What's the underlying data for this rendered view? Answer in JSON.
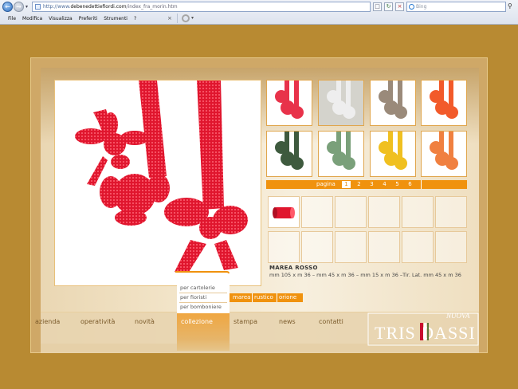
{
  "browser": {
    "address": {
      "prefix": "http://www.",
      "host": "debenedettiefiordi.com",
      "path": "/index_fra_morin.htm"
    },
    "search_placeholder": "Bing",
    "menu": [
      "File",
      "Modifica",
      "Visualizza",
      "Preferiti",
      "Strumenti",
      "?"
    ]
  },
  "site": {
    "thumbnails": {
      "colors": [
        "#e8324a",
        "#eeeeee",
        "#9a8a7a",
        "#f25a2a",
        "#3e5a3e",
        "#7aa07a",
        "#f0c020",
        "#f08040"
      ],
      "active_index": 1
    },
    "pagination": {
      "label": "pagina",
      "pages": [
        "1",
        "2",
        "3",
        "4",
        "5",
        "6"
      ],
      "current": "1"
    },
    "detail_swatch_color": "#e0162e",
    "product": {
      "title": "MAREA ROSSO",
      "description": "mm 105 x m 36 – mm 45 x m 36 – mm 15 x m 36 –Tir. Lat. mm 45 x m 36"
    },
    "submenu": [
      "per cartolerie",
      "per fioristi",
      "per bomboniere"
    ],
    "subtabs": [
      "marea",
      "rustico",
      "orione"
    ],
    "nav": [
      "azienda",
      "operatività",
      "novità",
      "collezione",
      "stampa",
      "news",
      "contatti"
    ],
    "nav_active": "collezione",
    "logo": {
      "top": "NUOVA",
      "main": "TRIS DASSI"
    },
    "colors": {
      "accent": "#f0920e",
      "ribbon_red": "#e0162e",
      "frame": "#cfa867"
    }
  }
}
